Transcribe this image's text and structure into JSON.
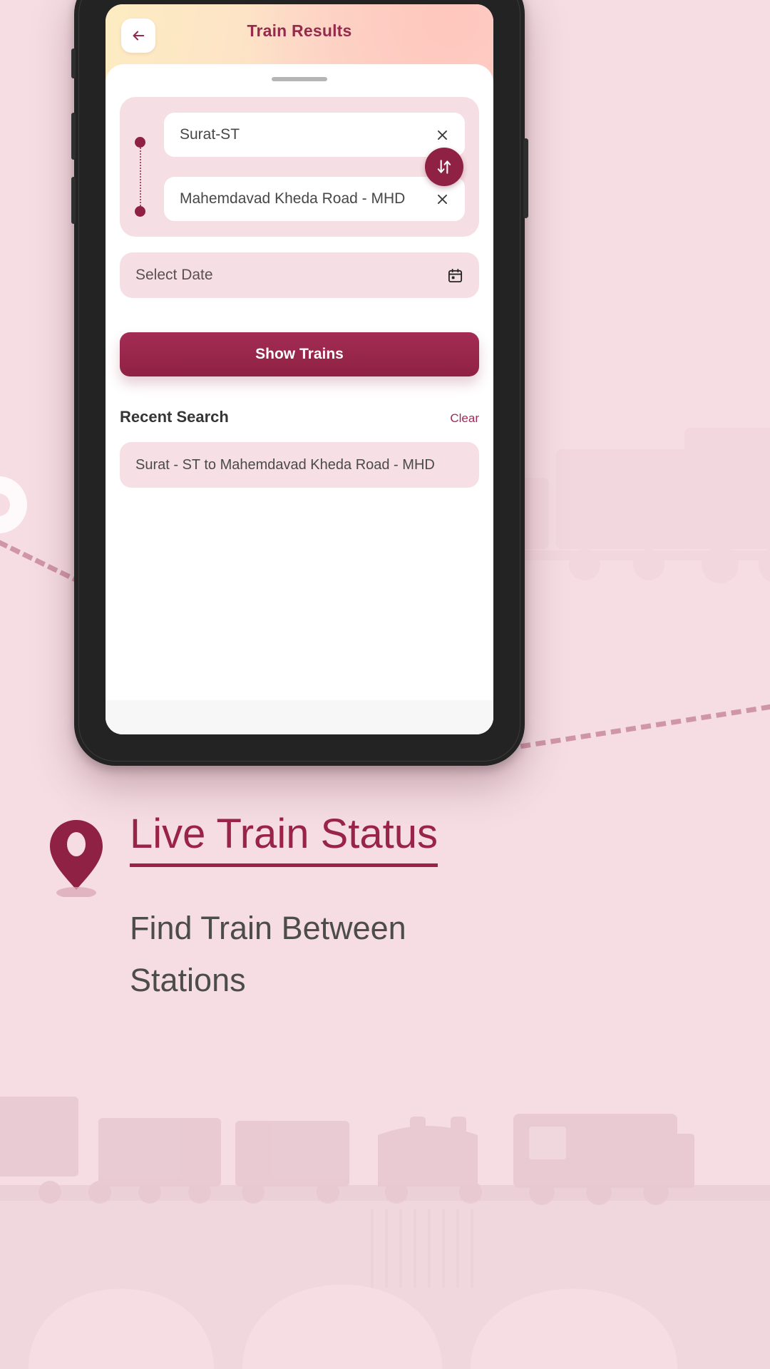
{
  "app": {
    "header": {
      "title": "Train Results",
      "back_icon": "arrow-left-icon"
    },
    "search_card": {
      "origin": {
        "value": "Surat-ST",
        "clear_icon": "close-icon"
      },
      "destination": {
        "value": "Mahemdavad Kheda Road - MHD",
        "clear_icon": "close-icon"
      },
      "swap_icon": "swap-vertical-icon"
    },
    "date_field": {
      "placeholder": "Select Date",
      "icon": "calendar-icon"
    },
    "primary_button": {
      "label": "Show Trains"
    },
    "recent": {
      "title": "Recent Search",
      "clear_label": "Clear",
      "items": [
        "Surat -  ST to Mahemdavad Kheda Road - MHD"
      ]
    }
  },
  "promo": {
    "pin_icon": "location-pin-icon",
    "title": "Live Train Status",
    "subtitle": "Find Train Between Stations"
  },
  "colors": {
    "brand": "#8f2144",
    "brand_light": "#a32c54",
    "page_background": "#f5dde3",
    "card_pink": "#f6dfe4",
    "header_gradient_start": "#fdecc2",
    "header_gradient_end": "#fbd2cd",
    "text_dark": "#474747",
    "promo_title": "#992447",
    "promo_subtitle": "#4c4c4c"
  }
}
